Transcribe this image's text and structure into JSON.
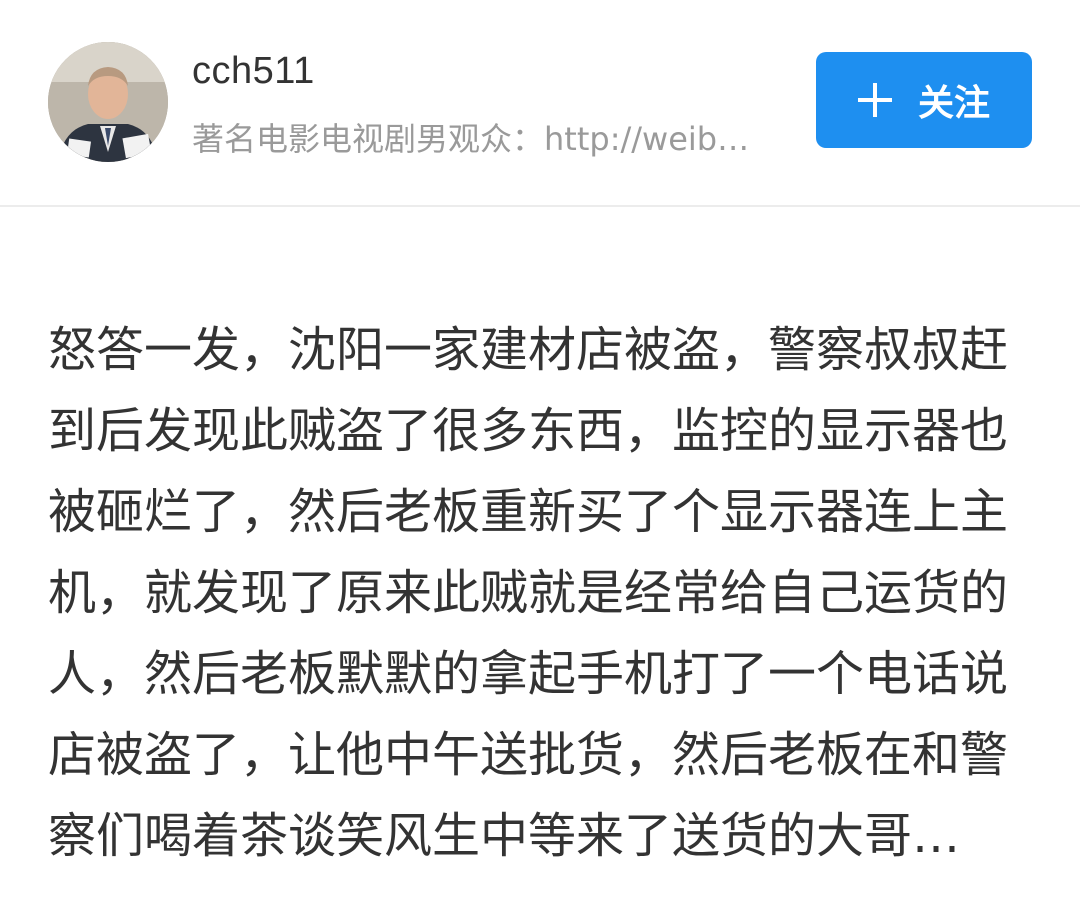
{
  "user": {
    "name": "cch511",
    "bio": "著名电影电视剧男观众：http://weib…",
    "avatar_icon": "user-avatar"
  },
  "follow_button": {
    "icon": "plus-icon",
    "label": "关注",
    "color": "#1e8ff0"
  },
  "post": {
    "lines": [
      "怒答一发，沈阳一家建材店被盗，警察叔叔赶",
      "到后发现此贼盗了很多东西，监控的显示器也",
      "被砸烂了，然后老板重新买了个显示器连上主",
      "机，就发现了原来此贼就是经常给自己运货的",
      "人，然后老板默默的拿起手机打了一个电话说",
      "店被盗了，让他中午送批货，然后老板在和警",
      "察们喝着茶谈笑风生中等来了送货的大哥…"
    ]
  }
}
